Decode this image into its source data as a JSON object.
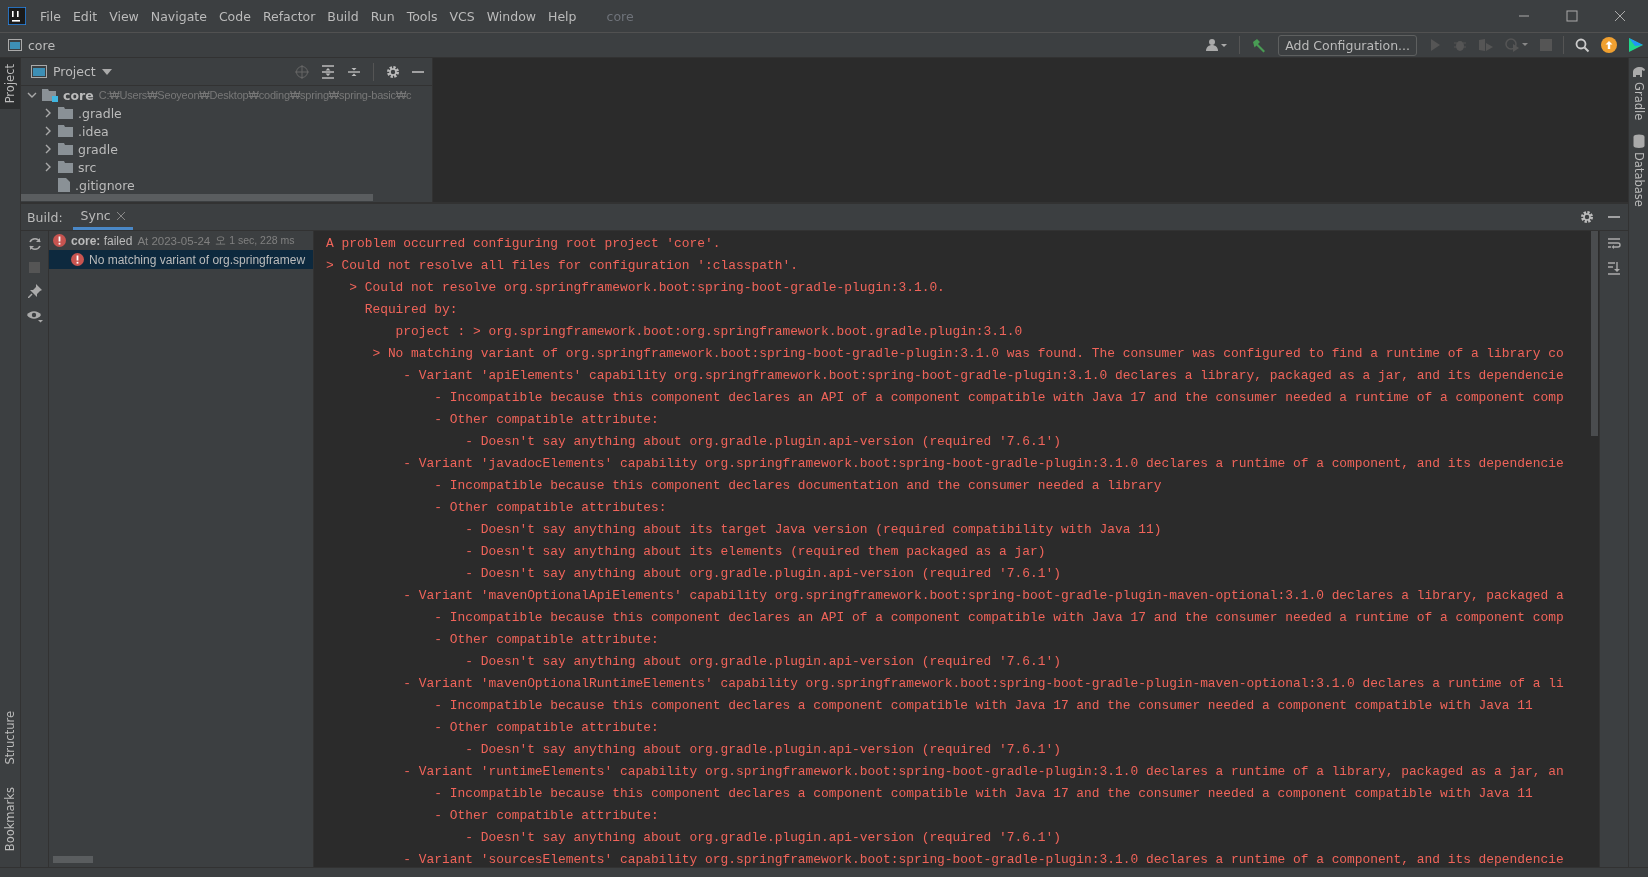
{
  "window": {
    "title": "core",
    "menu": [
      "File",
      "Edit",
      "View",
      "Navigate",
      "Code",
      "Refactor",
      "Build",
      "Run",
      "Tools",
      "VCS",
      "Window",
      "Help"
    ]
  },
  "navbar": {
    "crumb": "core"
  },
  "toolbar": {
    "run_config": "Add Configuration..."
  },
  "left_strip": [
    {
      "label": "Project",
      "selected": true
    },
    {
      "label": "Structure",
      "selected": false
    },
    {
      "label": "Bookmarks",
      "selected": false
    }
  ],
  "right_strip": [
    {
      "label": "Gradle",
      "kind": "gradle"
    },
    {
      "label": "Database",
      "kind": "database"
    }
  ],
  "project_panel": {
    "title": "Project",
    "tree": [
      {
        "name": "core",
        "path": "C:₩Users₩Seoyeon₩Desktop₩coding₩spring₩spring-basic₩c",
        "kind": "module",
        "expanded": true,
        "children": [
          {
            "name": ".gradle",
            "kind": "folder",
            "expanded": false
          },
          {
            "name": ".idea",
            "kind": "folder",
            "expanded": false
          },
          {
            "name": "gradle",
            "kind": "folder",
            "expanded": false
          },
          {
            "name": "src",
            "kind": "folder",
            "expanded": false
          },
          {
            "name": ".gitignore",
            "kind": "file"
          }
        ]
      }
    ]
  },
  "build": {
    "label": "Build:",
    "tabs": [
      {
        "label": "Sync",
        "selected": true
      }
    ],
    "tree": [
      {
        "status": "**core:** failed",
        "time": "At 2023-05-24",
        "duration": "오 1 sec, 228 ms",
        "selected": false,
        "children": [
          {
            "text": "No matching variant of org.springframew",
            "selected": true
          }
        ]
      }
    ],
    "console": [
      "A problem occurred configuring root project 'core'.",
      "> Could not resolve all files for configuration ':classpath'.",
      "   > Could not resolve org.springframework.boot:spring-boot-gradle-plugin:3.1.0.",
      "     Required by:",
      "         project : > org.springframework.boot:org.springframework.boot.gradle.plugin:3.1.0",
      "      > No matching variant of org.springframework.boot:spring-boot-gradle-plugin:3.1.0 was found. The consumer was configured to find a runtime of a library co",
      "          - Variant 'apiElements' capability org.springframework.boot:spring-boot-gradle-plugin:3.1.0 declares a library, packaged as a jar, and its dependencie",
      "              - Incompatible because this component declares an API of a component compatible with Java 17 and the consumer needed a runtime of a component comp",
      "              - Other compatible attribute:",
      "                  - Doesn't say anything about org.gradle.plugin.api-version (required '7.6.1')",
      "          - Variant 'javadocElements' capability org.springframework.boot:spring-boot-gradle-plugin:3.1.0 declares a runtime of a component, and its dependencie",
      "              - Incompatible because this component declares documentation and the consumer needed a library",
      "              - Other compatible attributes:",
      "                  - Doesn't say anything about its target Java version (required compatibility with Java 11)",
      "                  - Doesn't say anything about its elements (required them packaged as a jar)",
      "                  - Doesn't say anything about org.gradle.plugin.api-version (required '7.6.1')",
      "          - Variant 'mavenOptionalApiElements' capability org.springframework.boot:spring-boot-gradle-plugin-maven-optional:3.1.0 declares a library, packaged a",
      "              - Incompatible because this component declares an API of a component compatible with Java 17 and the consumer needed a runtime of a component comp",
      "              - Other compatible attribute:",
      "                  - Doesn't say anything about org.gradle.plugin.api-version (required '7.6.1')",
      "          - Variant 'mavenOptionalRuntimeElements' capability org.springframework.boot:spring-boot-gradle-plugin-maven-optional:3.1.0 declares a runtime of a li",
      "              - Incompatible because this component declares a component compatible with Java 17 and the consumer needed a component compatible with Java 11",
      "              - Other compatible attribute:",
      "                  - Doesn't say anything about org.gradle.plugin.api-version (required '7.6.1')",
      "          - Variant 'runtimeElements' capability org.springframework.boot:spring-boot-gradle-plugin:3.1.0 declares a runtime of a library, packaged as a jar, an",
      "              - Incompatible because this component declares a component compatible with Java 17 and the consumer needed a component compatible with Java 11",
      "              - Other compatible attribute:",
      "                  - Doesn't say anything about org.gradle.plugin.api-version (required '7.6.1')",
      "          - Variant 'sourcesElements' capability org.springframework.boot:spring-boot-gradle-plugin:3.1.0 declares a runtime of a component, and its dependencie"
    ]
  }
}
